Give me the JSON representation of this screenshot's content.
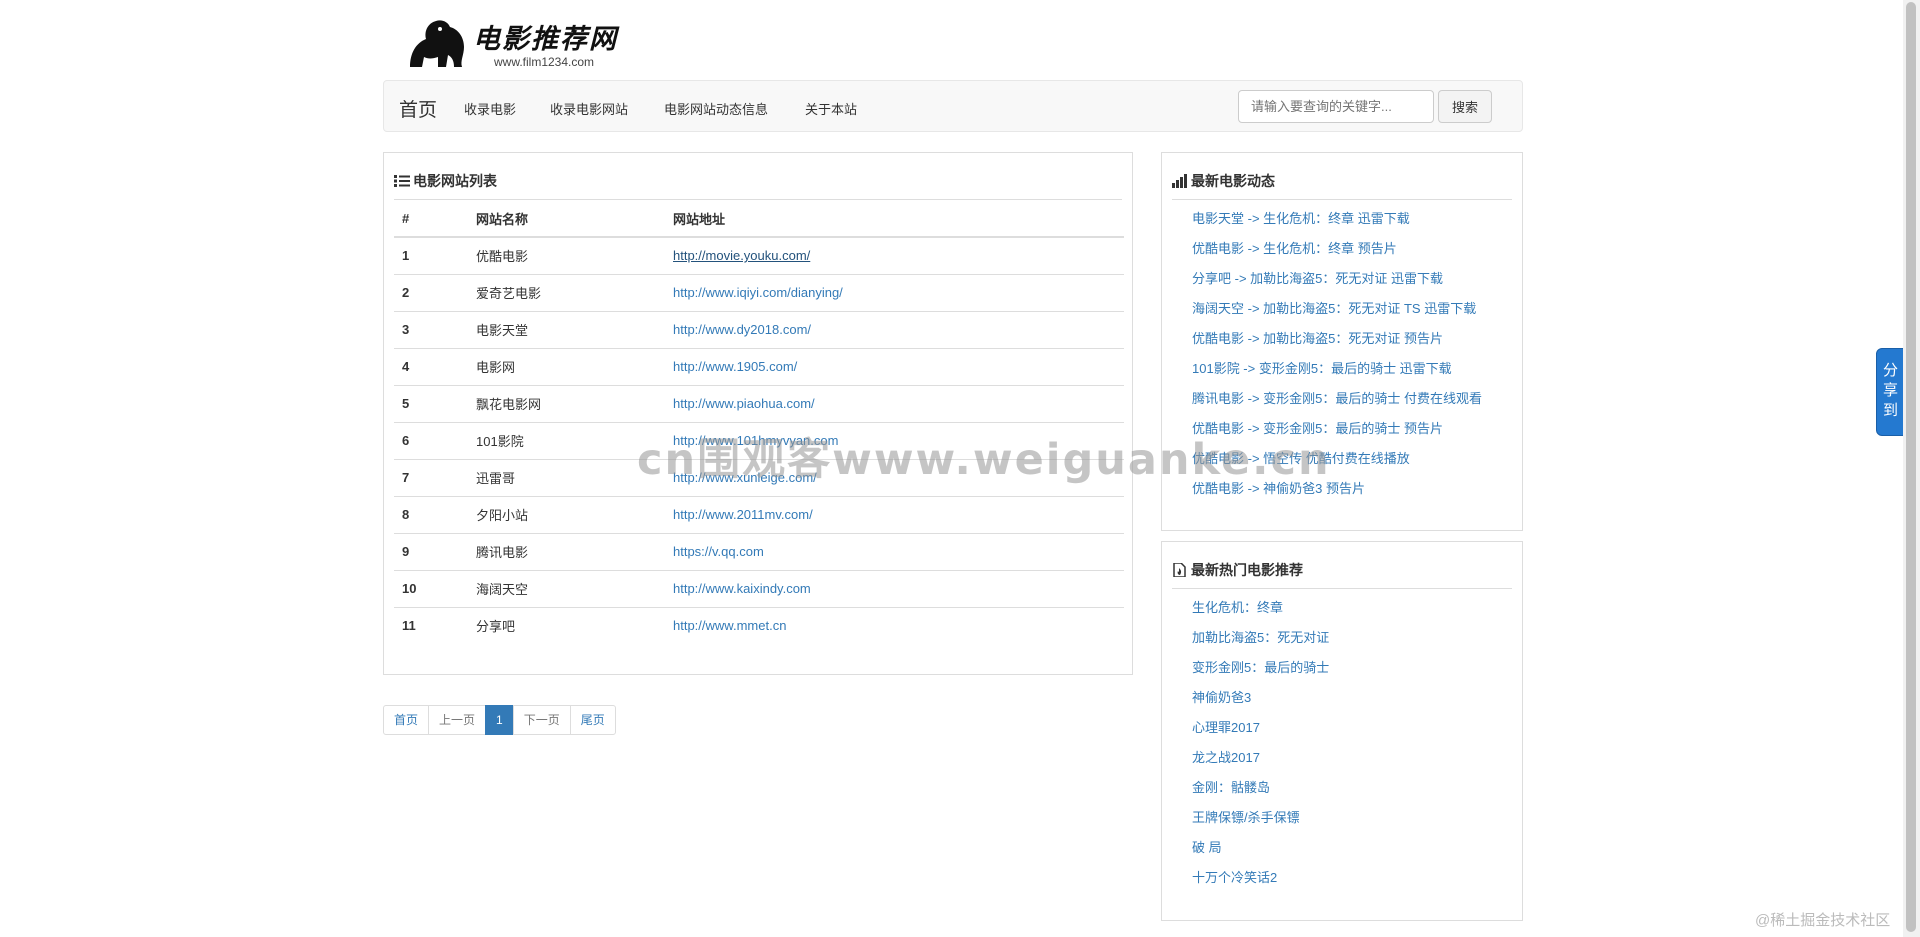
{
  "logo": {
    "text": "电影推荐网",
    "url": "www.film1234.com"
  },
  "nav": {
    "brand": "首页",
    "items": [
      "收录电影",
      "收录电影网站",
      "电影网站动态信息",
      "关于本站"
    ],
    "search_placeholder": "请输入要查询的关键字...",
    "search_button": "搜索"
  },
  "site_list": {
    "title": "电影网站列表",
    "headers": [
      "#",
      "网站名称",
      "网站地址"
    ],
    "rows": [
      {
        "num": "1",
        "name": "优酷电影",
        "url": "http://movie.youku.com/"
      },
      {
        "num": "2",
        "name": "爱奇艺电影",
        "url": "http://www.iqiyi.com/dianying/"
      },
      {
        "num": "3",
        "name": "电影天堂",
        "url": "http://www.dy2018.com/"
      },
      {
        "num": "4",
        "name": "电影网",
        "url": "http://www.1905.com/"
      },
      {
        "num": "5",
        "name": "飘花电影网",
        "url": "http://www.piaohua.com/"
      },
      {
        "num": "6",
        "name": "101影院",
        "url": "http://www.101hmyvyan.com"
      },
      {
        "num": "7",
        "name": "迅雷哥",
        "url": "http://www.xunleige.com/"
      },
      {
        "num": "8",
        "name": "夕阳小站",
        "url": "http://www.2011mv.com/"
      },
      {
        "num": "9",
        "name": "腾讯电影",
        "url": "https://v.qq.com"
      },
      {
        "num": "10",
        "name": "海阔天空",
        "url": "http://www.kaixindy.com"
      },
      {
        "num": "11",
        "name": "分享吧",
        "url": "http://www.mmet.cn"
      }
    ]
  },
  "pagination": {
    "first": "首页",
    "prev": "上一页",
    "current": "1",
    "next": "下一页",
    "last": "尾页"
  },
  "latest_news": {
    "title": "最新电影动态",
    "items": [
      "电影天堂 -> 生化危机：终章 迅雷下载",
      "优酷电影 -> 生化危机：终章 预告片",
      "分享吧 -> 加勒比海盗5：死无对证 迅雷下载",
      "海阔天空 -> 加勒比海盗5：死无对证 TS 迅雷下载",
      "优酷电影 -> 加勒比海盗5：死无对证 预告片",
      "101影院 -> 变形金刚5：最后的骑士 迅雷下载",
      "腾讯电影 -> 变形金刚5：最后的骑士 付费在线观看",
      "优酷电影 -> 变形金刚5：最后的骑士 预告片",
      "优酷电影 -> 悟空传 优酷付费在线播放",
      "优酷电影 -> 神偷奶爸3 预告片"
    ]
  },
  "hot_movies": {
    "title": "最新热门电影推荐",
    "items": [
      "生化危机：终章",
      "加勒比海盗5：死无对证",
      "变形金刚5：最后的骑士",
      "神偷奶爸3",
      "心理罪2017",
      "龙之战2017",
      "金刚：骷髅岛",
      "王牌保镖/杀手保镖",
      "破 局",
      "十万个冷笑话2"
    ]
  },
  "watermark": "cn围观客www.weiguanke.cn",
  "share_label": "分享到",
  "corner_mark": "@稀土掘金技术社区",
  "colors": {
    "link": "#337ab7",
    "active": "#337ab7",
    "share": "#2479d0"
  }
}
